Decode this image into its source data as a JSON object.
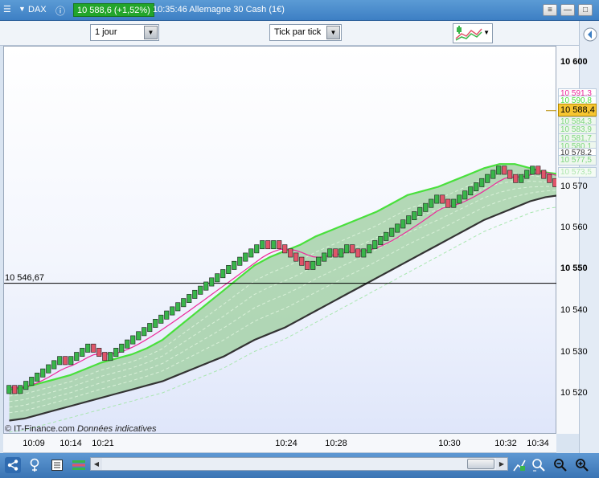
{
  "window": {
    "symbol": "DAX",
    "price_badge": "10 588,6 (+1,52%)",
    "title": "10:35:46 Allemagne 30 Cash (1€)"
  },
  "toolbar": {
    "period": "1 jour",
    "chart_mode": "Tick par tick"
  },
  "chart": {
    "hline_label": "10 546,67",
    "copyright": "© IT-Finance.com",
    "disclaimer": "Données indicatives",
    "y_ticks": [
      "10 600",
      "10 570",
      "10 560",
      "10 550",
      "10 540",
      "10 530",
      "10 520"
    ],
    "y_tags": [
      "10 591,3",
      "10 590,8",
      "10 588,4",
      "10 584,3",
      "10 583,9",
      "10 581,7",
      "10 580,1",
      "10 578,2",
      "10 577,5",
      "10 573,5"
    ],
    "x_ticks": [
      "10:09",
      "10:14",
      "10:21",
      "10:24",
      "10:28",
      "10:30",
      "10:32",
      "10:34"
    ]
  },
  "colors": {
    "up": "#39b54a",
    "down": "#e0556a",
    "band_fill": "#9ccd9d",
    "upper_line": "#49e03c",
    "lower_line": "#333333",
    "ma_line": "#ec2a9b",
    "price_tag": "#f7c631"
  },
  "chart_data": {
    "type": "renko",
    "brick_size": 1,
    "ylim": [
      10513,
      10605
    ],
    "reference_level": 10546.67,
    "last_price": 10588.4,
    "bricks": [
      {
        "o": 10521,
        "c": 10522
      },
      {
        "o": 10522,
        "c": 10521
      },
      {
        "o": 10521,
        "c": 10522
      },
      {
        "o": 10522,
        "c": 10523
      },
      {
        "o": 10523,
        "c": 10524
      },
      {
        "o": 10524,
        "c": 10525
      },
      {
        "o": 10525,
        "c": 10526
      },
      {
        "o": 10526,
        "c": 10527
      },
      {
        "o": 10527,
        "c": 10528
      },
      {
        "o": 10528,
        "c": 10529
      },
      {
        "o": 10529,
        "c": 10528
      },
      {
        "o": 10528,
        "c": 10529
      },
      {
        "o": 10529,
        "c": 10530
      },
      {
        "o": 10530,
        "c": 10531
      },
      {
        "o": 10531,
        "c": 10532
      },
      {
        "o": 10532,
        "c": 10531
      },
      {
        "o": 10531,
        "c": 10530
      },
      {
        "o": 10530,
        "c": 10529
      },
      {
        "o": 10529,
        "c": 10530
      },
      {
        "o": 10530,
        "c": 10531
      },
      {
        "o": 10531,
        "c": 10532
      },
      {
        "o": 10532,
        "c": 10533
      },
      {
        "o": 10533,
        "c": 10534
      },
      {
        "o": 10534,
        "c": 10535
      },
      {
        "o": 10535,
        "c": 10536
      },
      {
        "o": 10536,
        "c": 10537
      },
      {
        "o": 10537,
        "c": 10538
      },
      {
        "o": 10538,
        "c": 10539
      },
      {
        "o": 10539,
        "c": 10540
      },
      {
        "o": 10540,
        "c": 10541
      },
      {
        "o": 10541,
        "c": 10542
      },
      {
        "o": 10542,
        "c": 10543
      },
      {
        "o": 10543,
        "c": 10544
      },
      {
        "o": 10544,
        "c": 10545
      },
      {
        "o": 10545,
        "c": 10546
      },
      {
        "o": 10546,
        "c": 10547
      },
      {
        "o": 10547,
        "c": 10548
      },
      {
        "o": 10548,
        "c": 10549
      },
      {
        "o": 10549,
        "c": 10550
      },
      {
        "o": 10550,
        "c": 10551
      },
      {
        "o": 10551,
        "c": 10552
      },
      {
        "o": 10552,
        "c": 10553
      },
      {
        "o": 10553,
        "c": 10554
      },
      {
        "o": 10554,
        "c": 10555
      },
      {
        "o": 10555,
        "c": 10556
      },
      {
        "o": 10556,
        "c": 10557
      },
      {
        "o": 10557,
        "c": 10556
      },
      {
        "o": 10556,
        "c": 10557
      },
      {
        "o": 10557,
        "c": 10556
      },
      {
        "o": 10556,
        "c": 10555
      },
      {
        "o": 10555,
        "c": 10554
      },
      {
        "o": 10554,
        "c": 10553
      },
      {
        "o": 10553,
        "c": 10552
      },
      {
        "o": 10552,
        "c": 10551
      },
      {
        "o": 10551,
        "c": 10552
      },
      {
        "o": 10552,
        "c": 10553
      },
      {
        "o": 10553,
        "c": 10554
      },
      {
        "o": 10554,
        "c": 10555
      },
      {
        "o": 10555,
        "c": 10554
      },
      {
        "o": 10554,
        "c": 10555
      },
      {
        "o": 10555,
        "c": 10556
      },
      {
        "o": 10556,
        "c": 10555
      },
      {
        "o": 10555,
        "c": 10554
      },
      {
        "o": 10554,
        "c": 10555
      },
      {
        "o": 10555,
        "c": 10556
      },
      {
        "o": 10556,
        "c": 10557
      },
      {
        "o": 10557,
        "c": 10558
      },
      {
        "o": 10558,
        "c": 10559
      },
      {
        "o": 10559,
        "c": 10560
      },
      {
        "o": 10560,
        "c": 10561
      },
      {
        "o": 10561,
        "c": 10562
      },
      {
        "o": 10562,
        "c": 10563
      },
      {
        "o": 10563,
        "c": 10564
      },
      {
        "o": 10564,
        "c": 10565
      },
      {
        "o": 10565,
        "c": 10566
      },
      {
        "o": 10566,
        "c": 10567
      },
      {
        "o": 10567,
        "c": 10568
      },
      {
        "o": 10568,
        "c": 10567
      },
      {
        "o": 10567,
        "c": 10566
      },
      {
        "o": 10566,
        "c": 10567
      },
      {
        "o": 10567,
        "c": 10568
      },
      {
        "o": 10568,
        "c": 10569
      },
      {
        "o": 10569,
        "c": 10570
      },
      {
        "o": 10570,
        "c": 10571
      },
      {
        "o": 10571,
        "c": 10572
      },
      {
        "o": 10572,
        "c": 10573
      },
      {
        "o": 10573,
        "c": 10574
      },
      {
        "o": 10574,
        "c": 10575
      },
      {
        "o": 10575,
        "c": 10574
      },
      {
        "o": 10574,
        "c": 10573
      },
      {
        "o": 10573,
        "c": 10572
      },
      {
        "o": 10572,
        "c": 10573
      },
      {
        "o": 10573,
        "c": 10574
      },
      {
        "o": 10574,
        "c": 10575
      },
      {
        "o": 10575,
        "c": 10574
      },
      {
        "o": 10574,
        "c": 10573
      },
      {
        "o": 10573,
        "c": 10572
      },
      {
        "o": 10572,
        "c": 10571
      },
      {
        "o": 10571,
        "c": 10572
      }
    ],
    "series": [
      {
        "values": [
          10521,
          10521.5,
          10522.5,
          10523.5,
          10524.5,
          10526,
          10527.5,
          10528.5,
          10529.5,
          10531,
          10533,
          10536,
          10539,
          10542,
          10545,
          10548,
          10551,
          10553,
          10554.5,
          10556,
          10558,
          10559.5,
          10561,
          10562.5,
          10564,
          10566,
          10568,
          10569,
          10570,
          10571.5,
          10573,
          10574.5,
          10575.5,
          10575.5,
          10574.5,
          10573.5,
          10573
        ]
      },
      {
        "values": [
          10519,
          10520.5,
          10522,
          10523,
          10524,
          10525,
          10526.5,
          10527.5,
          10528.5,
          10530,
          10531.5,
          10533.5,
          10536,
          10539,
          10543,
          10546.5,
          10549,
          10550.5,
          10551.5,
          10552.5,
          10553.5,
          10555,
          10556,
          10557.5,
          10559,
          10560.5,
          10562,
          10563.5,
          10565,
          10566.5,
          10568,
          10569,
          10570,
          10570.5,
          10570.5,
          10570.5,
          10570.5
        ]
      },
      {
        "values": [
          10513.5,
          10514,
          10515,
          10516,
          10517,
          10518,
          10519,
          10520,
          10521,
          10522,
          10523,
          10524.5,
          10526,
          10527.5,
          10529,
          10531,
          10533,
          10534.5,
          10536,
          10538,
          10540,
          10542,
          10544,
          10546,
          10548,
          10550,
          10552,
          10554,
          10556,
          10558,
          10560,
          10562,
          10563.5,
          10565,
          10566.5,
          10567.5,
          10568
        ]
      }
    ]
  }
}
